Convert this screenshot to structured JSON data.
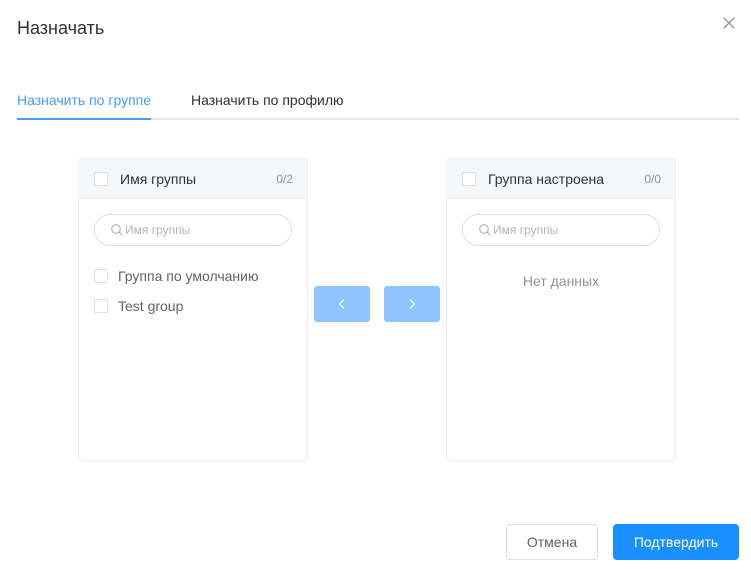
{
  "dialog": {
    "title": "Назначать"
  },
  "tabs": [
    {
      "label": "Назначить по группе",
      "active": true
    },
    {
      "label": "Назначить по профилю",
      "active": false
    }
  ],
  "left_panel": {
    "title": "Имя группы",
    "count": "0/2",
    "search_placeholder": "Имя группы",
    "items": [
      {
        "label": "Группа по умолчанию",
        "checked": false
      },
      {
        "label": "Test group",
        "checked": false
      }
    ]
  },
  "right_panel": {
    "title": "Группа настроена",
    "count": "0/0",
    "search_placeholder": "Имя группы",
    "empty_text": "Нет данных"
  },
  "transfer_buttons": {
    "to_left_icon": "chevron-left-icon",
    "to_right_icon": "chevron-right-icon"
  },
  "footer": {
    "cancel_label": "Отмена",
    "confirm_label": "Подтвердить"
  },
  "colors": {
    "accent": "#409eff",
    "primary_button": "#1890ff",
    "disabled_button": "#8cc5ff"
  }
}
